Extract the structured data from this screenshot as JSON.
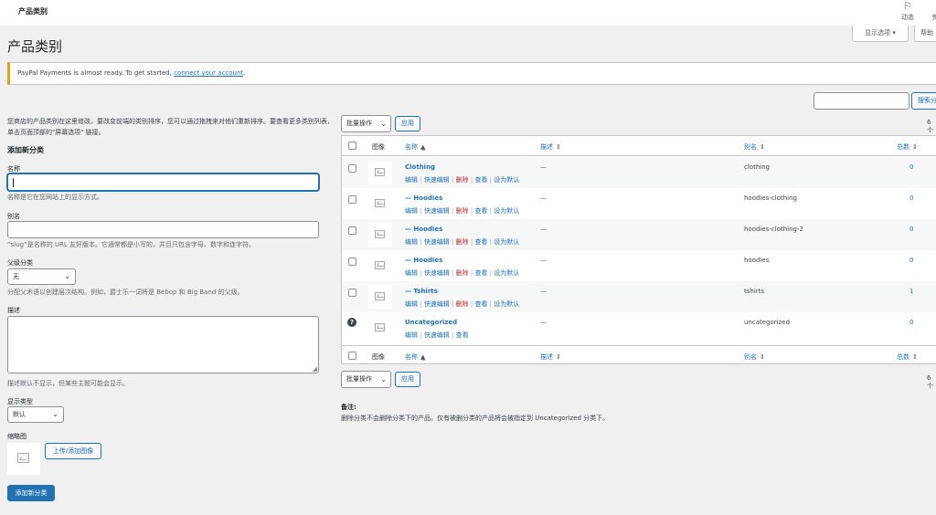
{
  "topbar": {
    "title": "产品类别",
    "activity": {
      "label": "动态",
      "icon": "flag-icon"
    },
    "finish": {
      "label": "完"
    }
  },
  "screen_options": "显示选项 ▾",
  "help_tab": "帮助",
  "page_title": "产品类别",
  "notice": {
    "text": "PayPal Payments is almost ready. To get started,",
    "link": "connect your account",
    "suffix": "."
  },
  "search": {
    "button": "搜索分"
  },
  "intro": "您商店的产品类别在这里修改。要改变前端的类别排序，您可以通过拖拽来对他们重新排序。要查看更多类别列表，单击页面顶部的\"屏幕选项\" 链接。",
  "form": {
    "heading": "添加新分类",
    "name_label": "名称",
    "name_desc": "名称是它在您网站上的显示方式。",
    "slug_label": "别名",
    "slug_desc": "“slug”是名称的 URL 友好版本。它通常都是小写的，并且只包含字母、数字和连字符。",
    "parent_label": "父级分类",
    "parent_value": "无",
    "parent_desc": "分配父术语以创建层次结构。例如，爵士乐一词将是 Bebop 和 Big Band 的父级。",
    "desc_label": "描述",
    "desc_desc": "描述默认不显示，但某些主题可能会显示。",
    "display_label": "显示类型",
    "display_value": "默认",
    "thumb_label": "缩略图",
    "upload_button": "上传/添加图像",
    "submit_button": "添加新分类"
  },
  "bulk": {
    "label": "批量操作",
    "apply": "应用",
    "count": "6个"
  },
  "table": {
    "headers": {
      "image": "图像",
      "name": "名称",
      "desc": "描述",
      "slug": "别名",
      "count": "总数"
    },
    "rows": [
      {
        "name": "Clothing",
        "desc": "—",
        "slug": "clothing",
        "count": "0"
      },
      {
        "name": "— Hoodies",
        "desc": "—",
        "slug": "hoodies-clothing",
        "count": "0"
      },
      {
        "name": "— Hoodies",
        "desc": "—",
        "slug": "hoodies-clothing-2",
        "count": "0"
      },
      {
        "name": "— Hoodies",
        "desc": "—",
        "slug": "hoodies",
        "count": "0"
      },
      {
        "name": "— Tshirts",
        "desc": "—",
        "slug": "tshirts",
        "count": "1"
      },
      {
        "name": "Uncategorized",
        "desc": "—",
        "slug": "uncategorized",
        "count": "0"
      }
    ],
    "actions": {
      "edit": "编辑",
      "quick": "快速编辑",
      "delete": "删除",
      "view": "查看",
      "default": "设为默认",
      "sep": " | "
    }
  },
  "note": {
    "heading": "备注:",
    "text": "删除分类不会删除分类下的产品。仅有被删分类的产品将会被指定到 Uncategorized 分类下。"
  }
}
